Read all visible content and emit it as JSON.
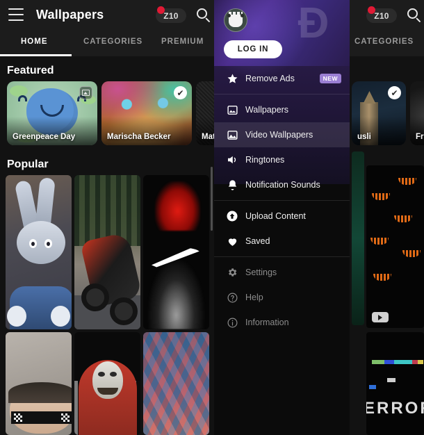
{
  "app": {
    "title": "Wallpapers",
    "menu_icon": "hamburger-icon",
    "search_icon": "search-icon",
    "credit_badge": "Z10"
  },
  "tabs": [
    {
      "label": "HOME",
      "active": true
    },
    {
      "label": "CATEGORIES",
      "active": false
    },
    {
      "label": "PREMIUM",
      "active": false
    }
  ],
  "right_screen": {
    "credit_badge": "Z10",
    "tab_label": "CATEGORIES"
  },
  "sections": {
    "featured": {
      "title": "Featured",
      "cards": [
        {
          "caption": "Greenpeace Day",
          "badge": "image-badge-icon"
        },
        {
          "caption": "Marischa Becker",
          "badge": "verified-badge-icon"
        },
        {
          "caption": "Mat",
          "badge": ""
        }
      ],
      "right_cards": [
        {
          "caption": "usli",
          "badge": "verified-badge-icon"
        },
        {
          "caption": "Fre",
          "badge": ""
        }
      ]
    },
    "popular": {
      "title": "Popular",
      "row1": [
        {
          "name": "bugs-bunny-wallpaper"
        },
        {
          "name": "motorcycle-wheelie-wallpaper"
        },
        {
          "name": "nike-smoke-wallpaper"
        }
      ],
      "row2": [
        {
          "name": "sand-sunglasses-wallpaper"
        },
        {
          "name": "money-heist-mask-wallpaper"
        },
        {
          "name": "city-aerial-wallpaper"
        }
      ],
      "right_cards": [
        {
          "name": "halloween-pumpkin-faces-wallpaper",
          "badge": "video-badge-icon"
        },
        {
          "name": "glitch-error-wallpaper",
          "text": "ERROR"
        }
      ]
    }
  },
  "drawer": {
    "logo": "zedge-logo",
    "avatar": "zedge-robot-avatar",
    "login_label": "LOG IN",
    "items": [
      {
        "label": "Remove Ads",
        "icon": "star-icon",
        "badge": "NEW",
        "state": "normal",
        "selected": false
      },
      {
        "label": "Wallpapers",
        "icon": "image-icon",
        "badge": "",
        "state": "normal",
        "selected": false
      },
      {
        "label": "Video Wallpapers",
        "icon": "video-image-icon",
        "badge": "",
        "state": "normal",
        "selected": true
      },
      {
        "label": "Ringtones",
        "icon": "speaker-icon",
        "badge": "",
        "state": "normal",
        "selected": false
      },
      {
        "label": "Notification Sounds",
        "icon": "bell-icon",
        "badge": "",
        "state": "normal",
        "selected": false
      },
      {
        "label": "Upload Content",
        "icon": "upload-circle-icon",
        "badge": "",
        "state": "normal",
        "selected": false
      },
      {
        "label": "Saved",
        "icon": "heart-icon",
        "badge": "",
        "state": "normal",
        "selected": false
      },
      {
        "label": "Settings",
        "icon": "gear-icon",
        "badge": "",
        "state": "dim",
        "selected": false
      },
      {
        "label": "Help",
        "icon": "help-circle-icon",
        "badge": "",
        "state": "dim",
        "selected": false
      },
      {
        "label": "Information",
        "icon": "info-circle-icon",
        "badge": "",
        "state": "dim",
        "selected": false
      }
    ]
  },
  "colors": {
    "accent_purple": "#9b7fd4",
    "badge_red": "#e01a35",
    "drawer_bg": "#0b0b0b",
    "screen_bg": "#121212"
  }
}
